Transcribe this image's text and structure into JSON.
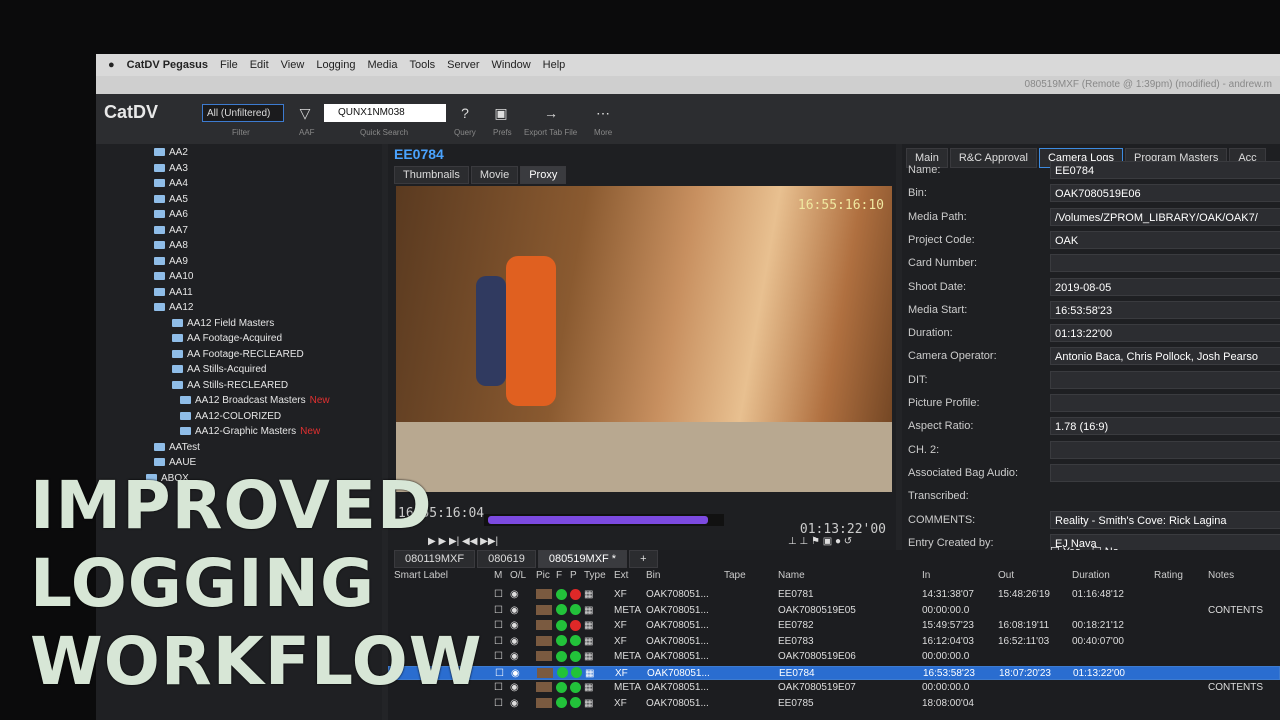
{
  "menubar": {
    "apple_icon": "apple-icon",
    "items": [
      "CatDV Pegasus",
      "File",
      "Edit",
      "View",
      "Logging",
      "Media",
      "Tools",
      "Server",
      "Window",
      "Help"
    ]
  },
  "titlebar": {
    "text": "080519MXF (Remote @ 1:39pm) (modified) - andrew.m"
  },
  "toolbar": {
    "logo": "CatDV",
    "filter_value": "All (Unfiltered)",
    "filter_label": "Filter",
    "aaf_label": "AAF",
    "search_value": "QUNX1NM038",
    "search_label": "Quick Search",
    "query_label": "Query",
    "prefs_label": "Prefs",
    "export_label": "Export Tab File",
    "more_label": "More"
  },
  "tree": {
    "items": [
      {
        "label": "AA2",
        "new": ""
      },
      {
        "label": "AA3",
        "new": ""
      },
      {
        "label": "AA4",
        "new": ""
      },
      {
        "label": "AA5",
        "new": ""
      },
      {
        "label": "AA6",
        "new": ""
      },
      {
        "label": "AA7",
        "new": ""
      },
      {
        "label": "AA8",
        "new": ""
      },
      {
        "label": "AA9",
        "new": ""
      },
      {
        "label": "AA10",
        "new": ""
      },
      {
        "label": "AA11",
        "new": ""
      },
      {
        "label": "AA12",
        "new": ""
      },
      {
        "label": "AA12 Field Masters",
        "new": ""
      },
      {
        "label": "AA Footage-Acquired",
        "new": ""
      },
      {
        "label": "AA Footage-RECLEARED",
        "new": ""
      },
      {
        "label": "AA Stills-Acquired",
        "new": ""
      },
      {
        "label": "AA Stills-RECLEARED",
        "new": ""
      },
      {
        "label": "AA12 Broadcast Masters",
        "new": "New"
      },
      {
        "label": "AA12-COLORIZED",
        "new": ""
      },
      {
        "label": "AA12-Graphic Masters",
        "new": "New"
      },
      {
        "label": "AATest",
        "new": ""
      },
      {
        "label": "AAUE",
        "new": ""
      },
      {
        "label": "ABOX",
        "new": ""
      }
    ]
  },
  "viewer": {
    "clip_id": "EE0784",
    "tabs": [
      "Thumbnails",
      "Movie",
      "Proxy"
    ],
    "active_tab": "Proxy",
    "burnin_timecode": "16:55:16:10",
    "current_timecode": "16:55:16:04",
    "duration_timecode": "01:13:22'00"
  },
  "details": {
    "tabs": [
      "Main",
      "R&C Approval",
      "Camera Logs",
      "Program Masters",
      "Acc"
    ],
    "active_tab": "Camera Logs",
    "fields": [
      {
        "label": "Name:",
        "value": "EE0784"
      },
      {
        "label": "Bin:",
        "value": "OAK7080519E06"
      },
      {
        "label": "Media Path:",
        "value": "/Volumes/ZPROM_LIBRARY/OAK/OAK7/"
      },
      {
        "label": "Project Code:",
        "value": "OAK"
      },
      {
        "label": "Card Number:",
        "value": ""
      },
      {
        "label": "Shoot Date:",
        "value": "2019-08-05"
      },
      {
        "label": "Media Start:",
        "value": "16:53:58'23"
      },
      {
        "label": "Duration:",
        "value": "01:13:22'00"
      },
      {
        "label": "Camera Operator:",
        "value": "Antonio Baca, Chris Pollock, Josh Pearso"
      },
      {
        "label": "DIT:",
        "value": ""
      },
      {
        "label": "Picture Profile:",
        "value": ""
      },
      {
        "label": "Aspect Ratio:",
        "value": "1.78 (16:9)"
      },
      {
        "label": "CH. 2:",
        "value": ""
      },
      {
        "label": "Associated Bag Audio:",
        "value": ""
      },
      {
        "label": "Transcribed:",
        "value": ""
      },
      {
        "label": "COMMENTS:",
        "value": "Reality - Smith's Cove: Rick Lagina"
      },
      {
        "label": "Entry Created by:",
        "value": "EJ Nava"
      }
    ],
    "transcribed_yes": "Yes",
    "transcribed_no": "No"
  },
  "grid": {
    "tabs": [
      "080119MXF",
      "080619",
      "080519MXF *",
      "+"
    ],
    "active_tab": "080519MXF *",
    "headers": [
      "Smart Label",
      "M",
      "O/L",
      "Pic",
      "F",
      "P",
      "Type",
      "Ext",
      "Bin",
      "Tape",
      "Name",
      "In",
      "Out",
      "Duration",
      "Rating",
      "Notes"
    ],
    "rows": [
      {
        "type": "XF",
        "bin": "OAK708051...",
        "name": "EE0781",
        "in": "14:31:38'07",
        "out": "15:48:26'19",
        "duration": "01:16:48'12",
        "notes": "",
        "selected": false
      },
      {
        "type": "META",
        "bin": "OAK708051...",
        "name": "OAK7080519E05",
        "in": "00:00:00.0",
        "out": "",
        "duration": "",
        "notes": "CONTENTS",
        "selected": false
      },
      {
        "type": "XF",
        "bin": "OAK708051...",
        "name": "EE0782",
        "in": "15:49:57'23",
        "out": "16:08:19'11",
        "duration": "00:18:21'12",
        "notes": "",
        "selected": false
      },
      {
        "type": "XF",
        "bin": "OAK708051...",
        "name": "EE0783",
        "in": "16:12:04'03",
        "out": "16:52:11'03",
        "duration": "00:40:07'00",
        "notes": "",
        "selected": false
      },
      {
        "type": "META",
        "bin": "OAK708051...",
        "name": "OAK7080519E06",
        "in": "00:00:00.0",
        "out": "",
        "duration": "",
        "notes": "",
        "selected": false
      },
      {
        "type": "XF",
        "bin": "OAK708051...",
        "name": "EE0784",
        "in": "16:53:58'23",
        "out": "18:07:20'23",
        "duration": "01:13:22'00",
        "notes": "",
        "selected": true
      },
      {
        "type": "META",
        "bin": "OAK708051...",
        "name": "OAK7080519E07",
        "in": "00:00:00.0",
        "out": "",
        "duration": "",
        "notes": "CONTENTS",
        "selected": false
      },
      {
        "type": "XF",
        "bin": "OAK708051...",
        "name": "EE0785",
        "in": "18:08:00'04",
        "out": "",
        "duration": "",
        "notes": "",
        "selected": false
      }
    ]
  },
  "overlay": {
    "line1": "IMPROVED",
    "line2": "LOGGING",
    "line3": "WORKFLOW"
  },
  "colors": {
    "accent": "#3d8be0",
    "selected_row": "#2a6dd0",
    "overlay_text": "#d7e6d6",
    "scrubber": "#7c4ae0",
    "status_green": "#22c23a",
    "status_red": "#e02828"
  }
}
